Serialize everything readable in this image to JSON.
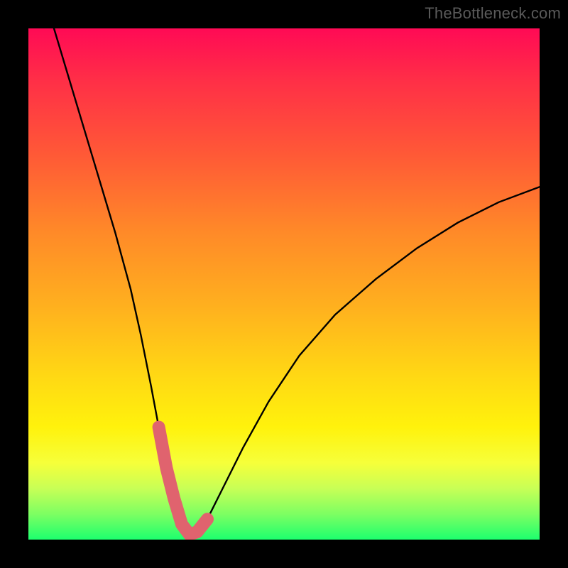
{
  "watermark": "TheBottleneck.com",
  "chart_data": {
    "type": "line",
    "title": "",
    "xlabel": "",
    "ylabel": "",
    "xlim": [
      0,
      100
    ],
    "ylim": [
      0,
      100
    ],
    "grid": false,
    "legend": false,
    "annotations": [],
    "series": [
      {
        "name": "bottleneck-curve",
        "color": "#000000",
        "x": [
          5,
          8,
          11,
          14,
          17,
          20,
          22,
          24,
          25.5,
          27,
          28.5,
          30,
          31.5,
          33,
          35,
          38,
          42,
          47,
          53,
          60,
          68,
          76,
          84,
          92,
          100
        ],
        "y": [
          100,
          90,
          80,
          70,
          60,
          49,
          40,
          30,
          22,
          14,
          8,
          3,
          1,
          1.5,
          4,
          10,
          18,
          27,
          36,
          44,
          51,
          57,
          62,
          66,
          69
        ]
      },
      {
        "name": "sweet-spot-marker",
        "color": "#e0636e",
        "thick": true,
        "x": [
          25.5,
          27,
          28.5,
          30,
          31.5,
          33,
          35
        ],
        "y": [
          22,
          14,
          8,
          3,
          1,
          1.5,
          4
        ]
      }
    ]
  }
}
